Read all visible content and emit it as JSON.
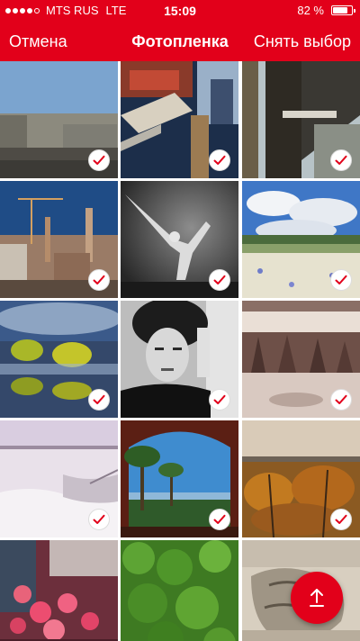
{
  "status_bar": {
    "carrier": "MTS RUS",
    "network": "LTE",
    "time": "15:09",
    "battery_text": "82 %",
    "battery_level": 0.82,
    "signal_filled": 4,
    "signal_total": 5
  },
  "nav": {
    "cancel_label": "Отмена",
    "title": "Фотопленка",
    "deselect_label": "Снять выбор"
  },
  "colors": {
    "accent": "#e2001a",
    "check_red": "#e2001a"
  },
  "photos": [
    {
      "name": "photo-city-square",
      "selected": true
    },
    {
      "name": "photo-boats-canal",
      "selected": true
    },
    {
      "name": "photo-bridge-structure",
      "selected": true
    },
    {
      "name": "photo-city-cranes",
      "selected": true
    },
    {
      "name": "photo-dancer-bw",
      "selected": true
    },
    {
      "name": "photo-flower-field-sky",
      "selected": true
    },
    {
      "name": "photo-flooded-trees",
      "selected": true
    },
    {
      "name": "photo-portrait-bw",
      "selected": true
    },
    {
      "name": "photo-winter-trees",
      "selected": true
    },
    {
      "name": "photo-snow-field",
      "selected": true
    },
    {
      "name": "photo-palm-trees-arch",
      "selected": true
    },
    {
      "name": "photo-autumn-trees",
      "selected": true
    },
    {
      "name": "photo-pink-roses",
      "selected": false
    },
    {
      "name": "photo-green-hedge",
      "selected": false
    },
    {
      "name": "photo-tree-trunk",
      "selected": false
    }
  ],
  "fab": {
    "icon": "upload-arrow-icon"
  }
}
